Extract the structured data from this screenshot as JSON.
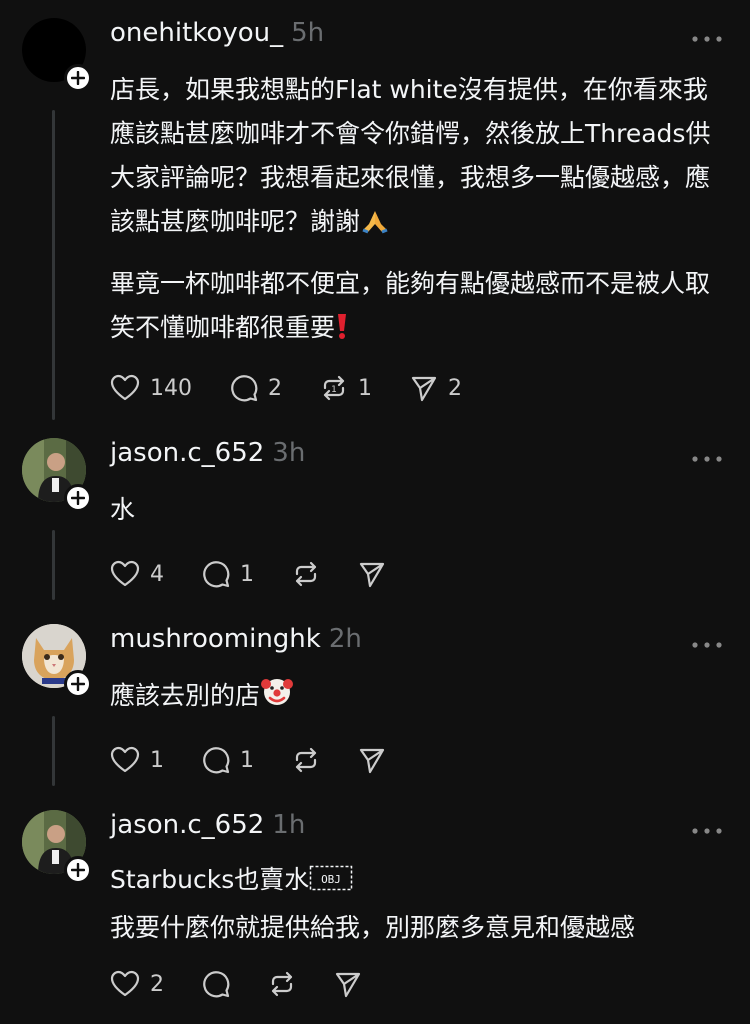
{
  "posts": [
    {
      "username": "onehitkoyou_",
      "time": "5h",
      "para1": "店長，如果我想點的Flat white沒有提供，在你看來我應該點甚麼咖啡才不會令你錯愕，然後放上Threads供大家評論呢？我想看起來很懂，我想多一點優越感，應該點甚麼咖啡呢？謝謝",
      "para2": "畢竟一杯咖啡都不便宜，能夠有點優越感而不是被人取笑不懂咖啡都很重要",
      "likes": "140",
      "comments": "2",
      "reposts": "1",
      "shares": "2"
    },
    {
      "username": "jason.c_652",
      "time": "3h",
      "text": "水",
      "likes": "4",
      "comments": "1"
    },
    {
      "username": "mushroominghk",
      "time": "2h",
      "text": "應該去別的店",
      "likes": "1",
      "comments": "1"
    },
    {
      "username": "jason.c_652",
      "time": "1h",
      "line1": "Starbucks也賣水",
      "line2": "我要什麼你就提供給我，別那麼多意見和優越感",
      "likes": "2"
    }
  ],
  "icons": {
    "like": "heart-icon",
    "comment": "comment-bubble-icon",
    "repost": "repost-icon",
    "share": "send-icon",
    "more": "more-dots-icon",
    "follow": "plus-icon",
    "pray": "folded-hands-emoji",
    "alert": "red-exclamation-emoji",
    "clown": "clown-face-emoji",
    "obj": "object-replacement-character"
  },
  "colors": {
    "background": "#101010",
    "text": "#f3f5f7",
    "muted": "#6a6d70",
    "line": "#333638"
  }
}
